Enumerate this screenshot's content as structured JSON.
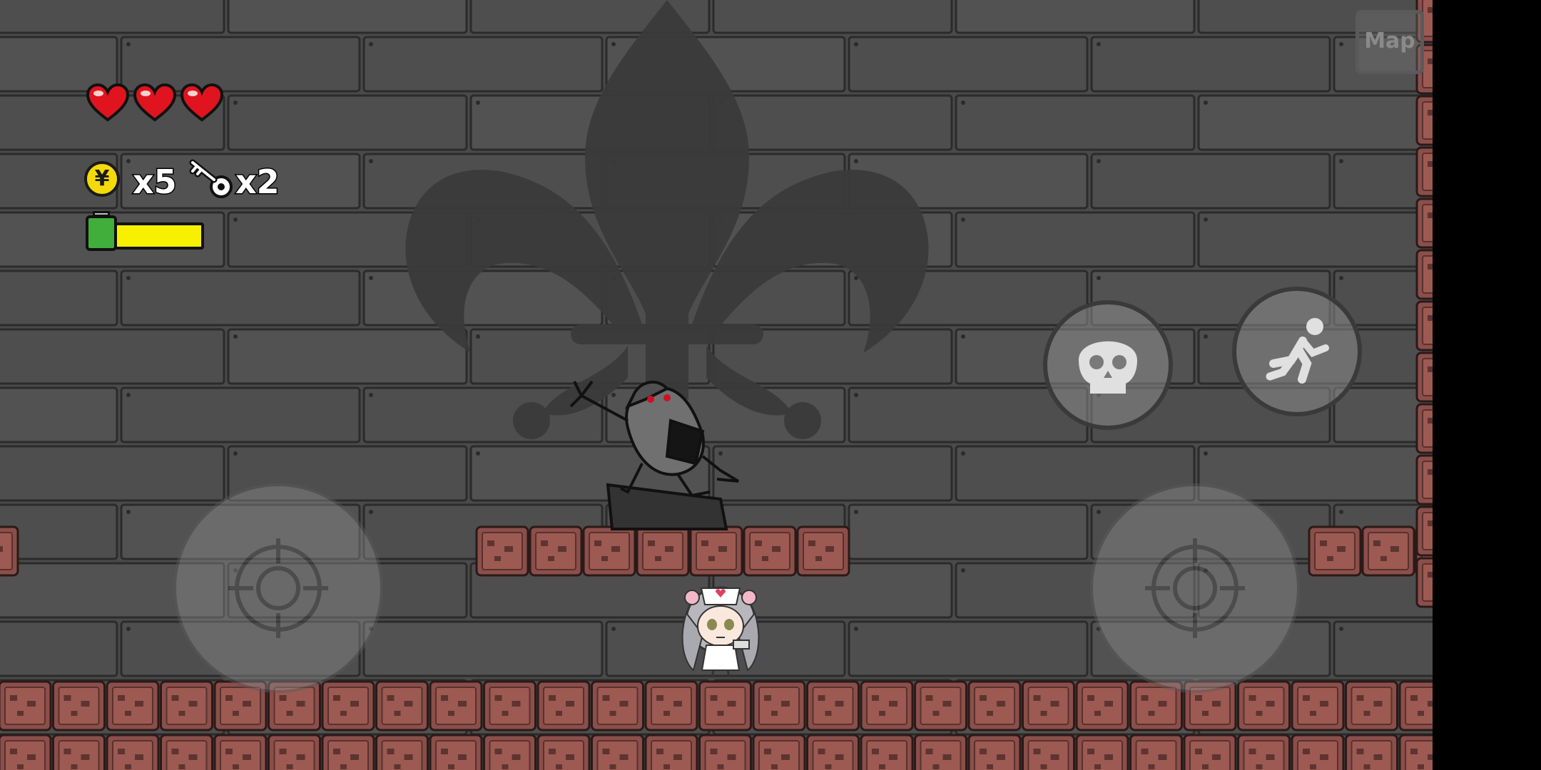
{
  "hud": {
    "hearts": 3,
    "coins_label": "x5",
    "keys_label": "x2",
    "coin_symbol": "¥",
    "energy_level": 1.0,
    "map_label": "Map"
  },
  "controls": {
    "move_joystick": "joystick-icon",
    "aim_joystick": "joystick-icon",
    "skill_button": "skull-icon",
    "dash_button": "running-icon"
  },
  "colors": {
    "wall": "#4a4a4a",
    "brick": "#8a4f4a",
    "heart": "#e0141e",
    "coin": "#f5d90a",
    "energy": "#f7f000"
  }
}
